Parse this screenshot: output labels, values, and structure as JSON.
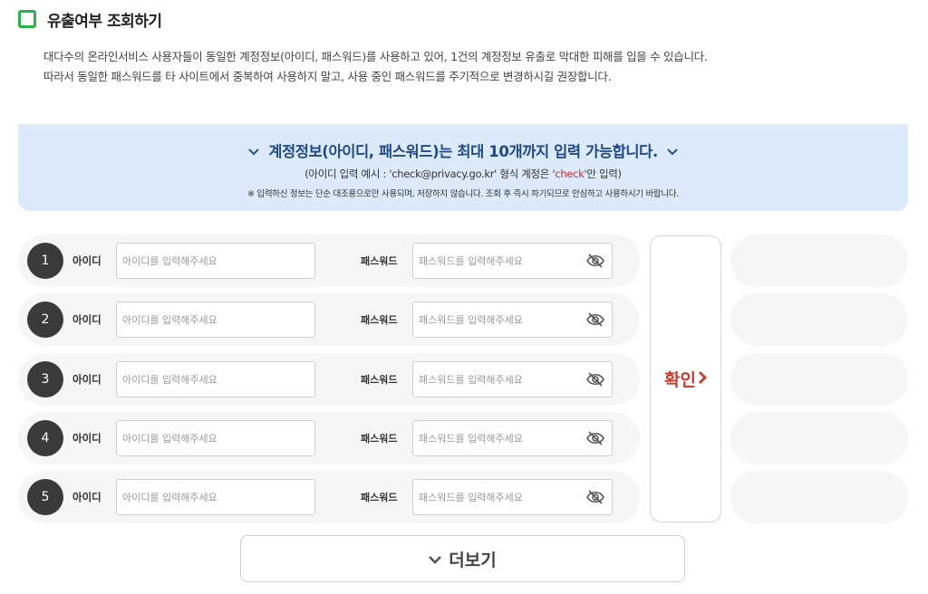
{
  "header": {
    "title": "유출여부 조회하기",
    "desc_line1": "대다수의 온라인서비스 사용자들이 동일한 계정정보(아이디, 패스워드)를 사용하고 있어, 1건의 계정정보 유출로 막대한 피해를 입을 수 있습니다.",
    "desc_line2": "따라서 동일한 패스워드를 타 사이트에서 중복하여 사용하지 말고, 사용 중인 패스워드를 주기적으로 변경하시길 권장합니다."
  },
  "notice": {
    "main": "계정정보(아이디, 패스워드)는 최대 10개까지 입력 가능합니다.",
    "sub_before": "(아이디 입력 예시 : 'check@privacy.go.kr' 형식 계정은 '",
    "sub_highlight": "check",
    "sub_after": "'만 입력)",
    "warning": "※ 입력하신 정보는 단순 대조용으로만 사용되며, 저장하지 않습니다. 조회 후 즉시 파기되므로 안심하고 사용하시기 바랍니다.",
    "highlight_color": "#d22a2a"
  },
  "rows": [
    {
      "num": "1",
      "id_label": "아이디",
      "id_value": "",
      "id_placeholder": "아이디를 입력해주세요",
      "pw_label": "패스워드",
      "pw_value": "",
      "pw_placeholder": "패스워드를 입력해주세요"
    },
    {
      "num": "2",
      "id_label": "아이디",
      "id_value": "",
      "id_placeholder": "아이디를 입력해주세요",
      "pw_label": "패스워드",
      "pw_value": "",
      "pw_placeholder": "패스워드를 입력해주세요"
    },
    {
      "num": "3",
      "id_label": "아이디",
      "id_value": "",
      "id_placeholder": "아이디를 입력해주세요",
      "pw_label": "패스워드",
      "pw_value": "",
      "pw_placeholder": "패스워드를 입력해주세요"
    },
    {
      "num": "4",
      "id_label": "아이디",
      "id_value": "",
      "id_placeholder": "아이디를 입력해주세요",
      "pw_label": "패스워드",
      "pw_value": "",
      "pw_placeholder": "패스워드를 입력해주세요"
    },
    {
      "num": "5",
      "id_label": "아이디",
      "id_value": "",
      "id_placeholder": "아이디를 입력해주세요",
      "pw_label": "패스워드",
      "pw_value": "",
      "pw_placeholder": "패스워드를 입력해주세요"
    }
  ],
  "icons": {
    "title": "checkbox-icon",
    "notice_chevrons": "chevron-down-icon",
    "password_toggle": "eye-off-icon",
    "confirm_arrow": "chevron-right-icon",
    "more": "chevron-down-icon"
  },
  "confirm": {
    "label": "확인",
    "arrow": "›",
    "color": "#c8392b"
  },
  "more": {
    "label": "더보기",
    "chevron": "⌄"
  },
  "colors": {
    "accent_green": "#2bb34a",
    "notice_bg": "#dceafb",
    "notice_text": "#1f4a8a",
    "row_bg": "#f6f6f6"
  }
}
